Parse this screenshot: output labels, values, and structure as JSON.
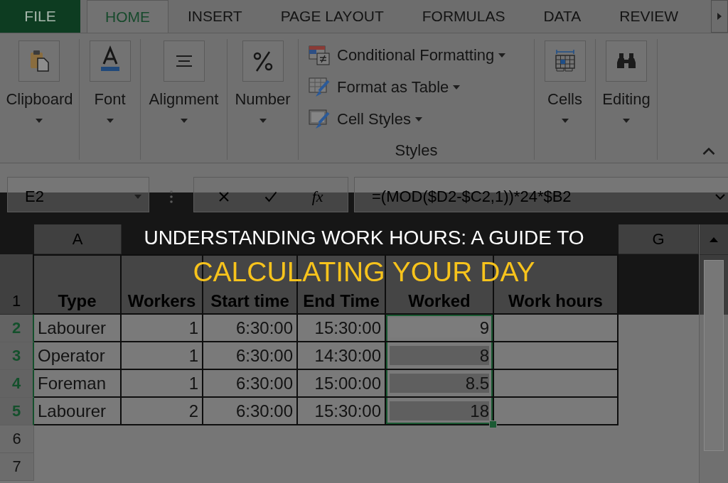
{
  "ribbon_tabs": [
    {
      "label": "FILE",
      "kind": "backstage",
      "selected": false
    },
    {
      "label": "HOME",
      "kind": "tab",
      "selected": true
    },
    {
      "label": "INSERT",
      "kind": "tab",
      "selected": false
    },
    {
      "label": "PAGE LAYOUT",
      "kind": "tab",
      "selected": false
    },
    {
      "label": "FORMULAS",
      "kind": "tab",
      "selected": false
    },
    {
      "label": "DATA",
      "kind": "tab",
      "selected": false
    },
    {
      "label": "REVIEW",
      "kind": "tab",
      "selected": false
    }
  ],
  "ribbon_groups": [
    {
      "label": "Clipboard",
      "kind": "collapsed"
    },
    {
      "label": "Font",
      "kind": "collapsed"
    },
    {
      "label": "Alignment",
      "kind": "collapsed"
    },
    {
      "label": "Number",
      "kind": "collapsed"
    },
    {
      "label": "Styles",
      "kind": "expanded",
      "items": [
        "Conditional Formatting",
        "Format as Table",
        "Cell Styles"
      ]
    },
    {
      "label": "Cells",
      "kind": "collapsed"
    },
    {
      "label": "Editing",
      "kind": "collapsed"
    }
  ],
  "formula_bar": {
    "name_box": "E2",
    "function_label": "fx",
    "formula": "=(MOD($D2-$C2,1))*24*$B2"
  },
  "sheet": {
    "columns": [
      {
        "letter": "A",
        "title": "Type",
        "selected": false
      },
      {
        "title": "Workers",
        "selected": false
      },
      {
        "title": "Start time",
        "selected": false
      },
      {
        "title": "End Time",
        "selected": false
      },
      {
        "title": "Worked",
        "selected": true
      },
      {
        "title": "Work hours",
        "selected": false
      },
      {
        "letter": "G",
        "selected": false
      }
    ],
    "header_row": "1",
    "rows": [
      {
        "number": "2",
        "selected": true,
        "active": true,
        "cells": [
          "Labourer",
          "1",
          "6:30:00",
          "15:30:00",
          "9"
        ]
      },
      {
        "number": "3",
        "selected": true,
        "active": false,
        "cells": [
          "Operator",
          "1",
          "6:30:00",
          "14:30:00",
          "8"
        ]
      },
      {
        "number": "4",
        "selected": true,
        "active": false,
        "cells": [
          "Foreman",
          "1",
          "6:30:00",
          "15:00:00",
          "8.5"
        ]
      },
      {
        "number": "5",
        "selected": true,
        "active": false,
        "cells": [
          "Labourer",
          "2",
          "6:30:00",
          "15:30:00",
          "18"
        ]
      },
      {
        "number": "6",
        "selected": false
      },
      {
        "number": "7",
        "selected": false
      }
    ]
  },
  "banner": {
    "title": "UNDERSTANDING WORK HOURS: A GUIDE TO",
    "subtitle": "CALCULATING YOUR DAY"
  }
}
